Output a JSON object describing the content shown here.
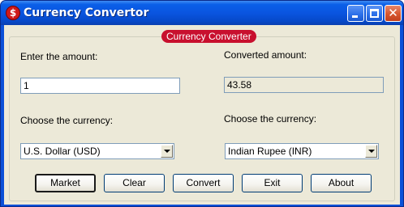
{
  "window": {
    "title": "Currency Convertor",
    "icon_glyph": "$",
    "caption_close": "✕"
  },
  "group": {
    "label": "Currency Converter"
  },
  "form": {
    "amount_label": "Enter the amount:",
    "amount_value": "1",
    "converted_label": "Converted amount:",
    "converted_value": "43.58",
    "from_currency_label": "Choose the currency:",
    "from_currency_value": "U.S. Dollar (USD)",
    "to_currency_label": "Choose the currency:",
    "to_currency_value": "Indian Rupee (INR)"
  },
  "buttons": {
    "market": "Market",
    "clear": "Clear",
    "convert": "Convert",
    "exit": "Exit",
    "about": "About"
  },
  "colors": {
    "titlebar": "#0a55e0",
    "group_badge": "#c8102e",
    "dialog_bg": "#ece9d8"
  }
}
